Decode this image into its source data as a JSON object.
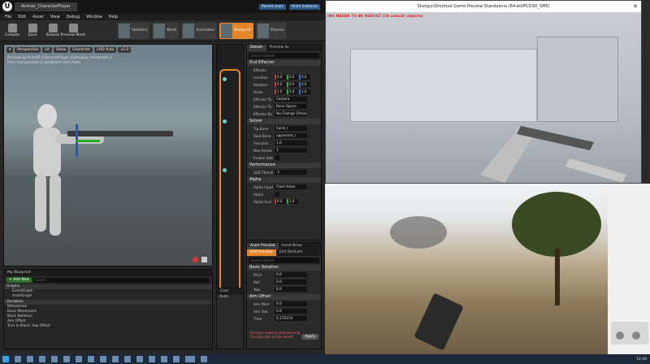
{
  "titlebar": {
    "doc_tab": "Animer_CharacterPlayer",
    "badge_parent": "Parent class",
    "badge_anim": "Anim Instance"
  },
  "menu": [
    "File",
    "Edit",
    "Asset",
    "View",
    "Debug",
    "Window",
    "Help"
  ],
  "toolbar": {
    "buttons": [
      "Compile",
      "Save",
      "Browse",
      "Preview Mesh"
    ],
    "modes": [
      "Skeleton",
      "Mesh",
      "Animation",
      "Blueprint",
      "Physics"
    ],
    "active_mode": "Blueprint"
  },
  "viewport": {
    "buttons": [
      "Perspective",
      "Lit",
      "Show",
      "Character",
      "LOD Auto",
      "x1.0"
    ],
    "line1": "Previewing AnimBP_CharacterPlayer_Gameplay_Interpolate_C",
    "line2": "Error manipulation is disabled in this mode."
  },
  "details": {
    "tabs": [
      "Details",
      "Preview Sc"
    ],
    "search_placeholder": "Search Details",
    "end_effector": {
      "section": "End Effector",
      "effector_label": "Effector",
      "location_label": "Location",
      "rotation_label": "Rotation",
      "scale_label": "Scale",
      "loc": [
        "0.0",
        "0.0",
        "0.0"
      ],
      "rot": [
        "0.0",
        "0.0",
        "0.0"
      ],
      "scl": [
        "1.0",
        "1.0",
        "1.0"
      ],
      "target_label": "Effector Ta",
      "target_value": "Camera",
      "bone_space_label": "Effector To",
      "bone_space_value": "Bone Space",
      "no_change_label": "Effector Ro",
      "no_change_value": "No Change (Prese"
    },
    "solver": {
      "section": "Solver",
      "tip_bone_label": "Tip Bone",
      "tip_bone": "hand_r",
      "root_bone_label": "Root Bone",
      "root_bone": "upperarm_r",
      "precision_label": "Precision",
      "precision": "1.0",
      "max_iter_label": "Max Iterati",
      "max_iter": "1",
      "enable_debug_label": "Enable Deb"
    },
    "performance": {
      "section": "Performance",
      "lod_label": "LOD Thresh",
      "lod": "-1"
    },
    "alpha": {
      "section": "Alpha",
      "input_label": "Alpha Input",
      "input": "Float Value",
      "alpha_label": "Alpha",
      "scale_label": "Alpha Scal",
      "scale": [
        "0.0",
        "1.0"
      ]
    }
  },
  "preview": {
    "tabs": [
      "Anim Preview",
      "Asset Brow"
    ],
    "subtabs": [
      "Edit Preview",
      "Edit Defaults"
    ],
    "search_placeholder": "Search Details",
    "basic_rotation": "Basic Rotation",
    "pitch_label": "Pitch",
    "pitch": "0.0",
    "roll_label": "Roll",
    "roll": "0.0",
    "yaw_label": "Yaw",
    "yaw": "0.0",
    "aim_offset": "Aim Offset",
    "aim_pitch_label": "Aim Pitch",
    "aim_pitch": "0.0",
    "aim_yaw_label": "Aim Yaw",
    "aim_yaw": "0.0",
    "time_label": "Time",
    "time": "0.170374",
    "note": "Changes made to preview only. Changes will not be saved!",
    "apply": "Apply"
  },
  "myblueprint": {
    "title": "My Blueprint",
    "add_new": "+ Add New",
    "search_placeholder": "Search",
    "graphs_cat": "Graphs",
    "graphs": [
      "EventGraph",
      "AnimGraph"
    ],
    "variables_cat": "Variables",
    "var_cats": [
      "References",
      "Basic Movement",
      "Basic Rotation",
      "Aim Offset",
      "Turn In Place: Yaw Offset"
    ]
  },
  "smallpanel": {
    "title": "Com",
    "item": "Anim"
  },
  "game1": {
    "title": "ShotgunShootout Game Preview Standalone (64-bit/PCD3D_SM5)",
    "warning": "ING NEEDS TO BE REBUILT (50 unbuilt objects)"
  },
  "taskbar": {
    "clock": "12:49"
  },
  "colors": {
    "accent": "#e5862a",
    "warning_red": "#ee2222"
  }
}
